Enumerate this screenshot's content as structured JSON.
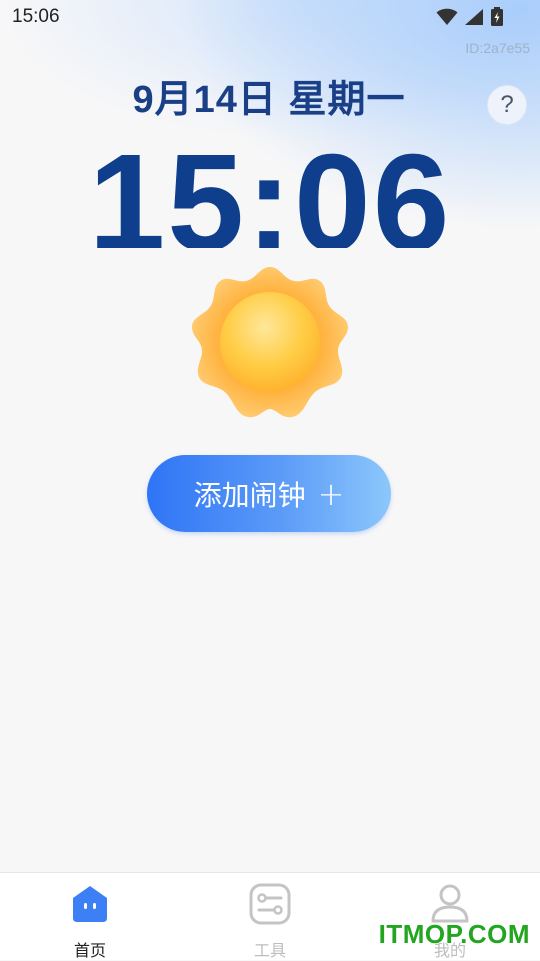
{
  "status_bar": {
    "time": "15:06"
  },
  "watermark_id": "ID:2a7e55",
  "header": {
    "date": "9月14日 星期一",
    "help_label": "?"
  },
  "clock": {
    "time": "15:06"
  },
  "add_alarm": {
    "label": "添加闹钟",
    "plus": "+"
  },
  "tabbar": {
    "tabs": [
      {
        "label": "首页",
        "active": true
      },
      {
        "label": "工具",
        "active": false
      },
      {
        "label": "我的",
        "active": false
      }
    ]
  },
  "overlay_logo": "ITMOP.COM",
  "colors": {
    "accent": "#3a7cf5",
    "date_text": "#1a3f87",
    "clock_text": "#0f3f8c",
    "inactive_tab": "#bfbfbf",
    "logo": "#22a51f"
  },
  "icons": {
    "status": [
      "wifi-icon",
      "signal-icon",
      "battery-icon"
    ],
    "tabs": [
      "home-icon",
      "tools-icon",
      "user-icon"
    ],
    "weather": "sun-icon"
  }
}
